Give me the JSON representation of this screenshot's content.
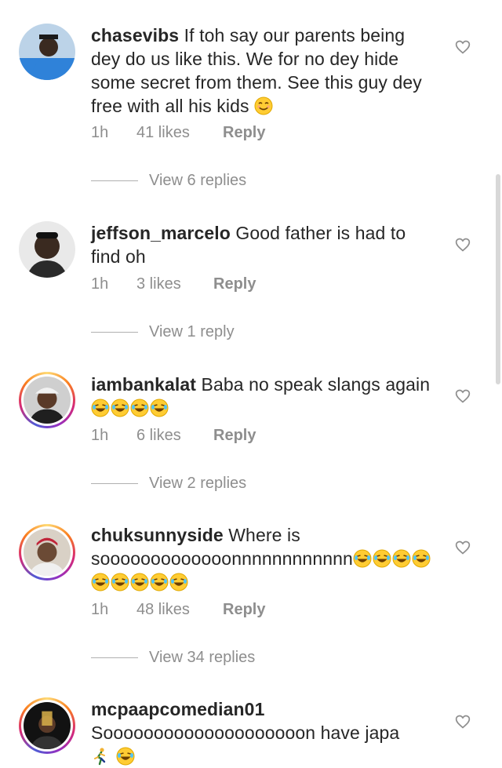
{
  "comments": [
    {
      "username": "chasevibs",
      "text": "If toh say our parents being dey do us like this. We for no dey hide some secret from them. See this guy dey free with all his kids",
      "emoji": "😊",
      "time": "1h",
      "likes": "41 likes",
      "reply": "Reply",
      "view_replies": "View 6 replies",
      "story_ring": false
    },
    {
      "username": "jeffson_marcelo",
      "text": "Good father is had to find oh",
      "emoji": "",
      "time": "1h",
      "likes": "3 likes",
      "reply": "Reply",
      "view_replies": "View 1 reply",
      "story_ring": false
    },
    {
      "username": "iambankalat",
      "text": "Baba no speak slangs again",
      "emoji": "😂😂😂😂",
      "time": "1h",
      "likes": "6 likes",
      "reply": "Reply",
      "view_replies": "View 2 replies",
      "story_ring": true
    },
    {
      "username": "chuksunnyside",
      "text": "Where is sooooooooooooonnnnnnnnnnnn",
      "emoji": "😂😂😂😂😂😂😂😂😂",
      "time": "1h",
      "likes": "48 likes",
      "reply": "Reply",
      "view_replies": "View 34 replies",
      "story_ring": true
    },
    {
      "username": "mcpaapcomedian01",
      "text": "Soooooooooooooooooooon have japa",
      "emoji": "🏃😂",
      "time": "",
      "likes": "",
      "reply": "",
      "view_replies": "",
      "story_ring": true
    }
  ],
  "icons": {
    "like": "heart-outline-icon",
    "laugh": "laughing-face-icon",
    "smile": "smiling-face-icon",
    "runner": "running-person-icon"
  },
  "colors": {
    "text": "#262626",
    "muted": "#8e8e8e",
    "ring_start": "#feda75",
    "ring_end": "#d62976"
  }
}
